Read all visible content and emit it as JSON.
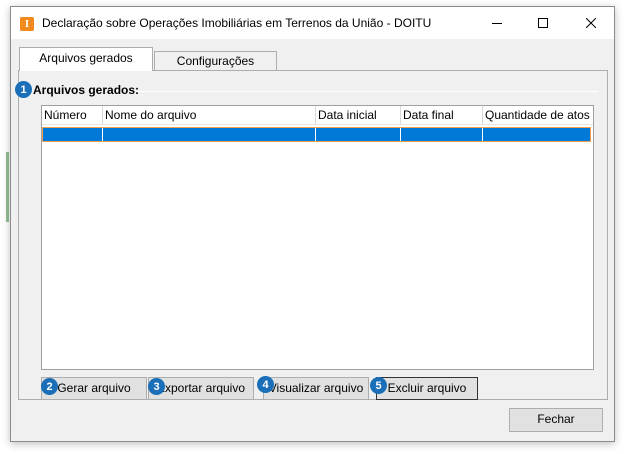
{
  "window": {
    "title": "Declaração sobre Operações Imobiliárias em Terrenos da União - DOITU",
    "icon_letter": "I",
    "icon_color": "#f08a1c"
  },
  "tabs": [
    {
      "label": "Arquivos gerados",
      "active": true
    },
    {
      "label": "Configurações",
      "active": false
    }
  ],
  "group": {
    "title": "Arquivos gerados:",
    "badge": "1"
  },
  "table": {
    "columns": [
      "Número",
      "Nome do arquivo",
      "Data inicial",
      "Data final",
      "Quantidade de atos"
    ],
    "rows": [
      [
        "",
        "",
        "",
        "",
        ""
      ]
    ],
    "selection_color": "#0078d7"
  },
  "actions": [
    {
      "badge": "2",
      "label": "Gerar arquivo"
    },
    {
      "badge": "3",
      "label": "Exportar arquivo"
    },
    {
      "badge": "4",
      "label": "Visualizar arquivo"
    },
    {
      "badge": "5",
      "label": "Excluir arquivo"
    }
  ],
  "footer": {
    "close_label": "Fechar"
  },
  "badge_color": "#1a6fb8"
}
